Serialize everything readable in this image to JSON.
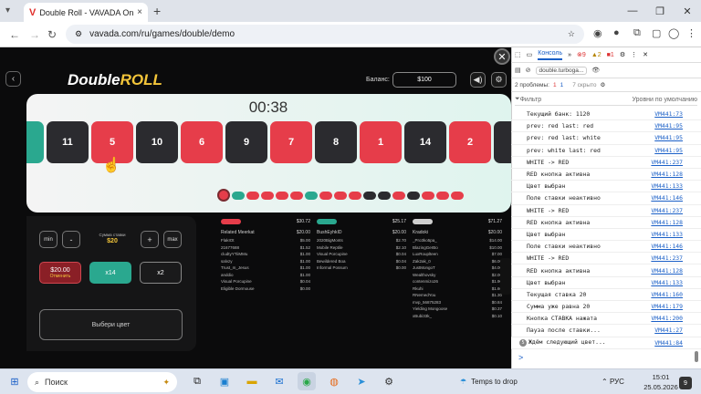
{
  "browser": {
    "tab_title": "Double Roll - VAVADA Onli",
    "tab_favicon": "V",
    "url": "vavada.com/ru/games/double/demo",
    "new_tab": "+",
    "close_tab": "×"
  },
  "game": {
    "logo_part1": "Double",
    "logo_part2": "ROLL",
    "balance_label": "Баланс:",
    "balance_value": "$100",
    "timer": "00:38",
    "tiles": [
      {
        "num": "",
        "color": "green"
      },
      {
        "num": "11",
        "color": "black"
      },
      {
        "num": "5",
        "color": "red"
      },
      {
        "num": "10",
        "color": "black"
      },
      {
        "num": "6",
        "color": "red"
      },
      {
        "num": "9",
        "color": "black"
      },
      {
        "num": "7",
        "color": "red"
      },
      {
        "num": "8",
        "color": "black"
      },
      {
        "num": "1",
        "color": "red"
      },
      {
        "num": "14",
        "color": "black"
      },
      {
        "num": "2",
        "color": "red"
      },
      {
        "num": "",
        "color": "black"
      }
    ],
    "history": [
      "red",
      "green",
      "red",
      "red",
      "red",
      "red",
      "green",
      "red",
      "red",
      "red",
      "black",
      "black",
      "red",
      "black",
      "red",
      "red",
      "red"
    ],
    "controls": {
      "min": "min",
      "minus": "-",
      "bet_label": "Сумма ставки",
      "bet_value": "$20",
      "plus": "+",
      "max": "max"
    },
    "picks": {
      "red_amount": "$20.00",
      "red_status": "Отменить",
      "green": "x14",
      "black": "x2"
    },
    "choose_color": "Выбери цвет",
    "columns": [
      {
        "pill_color": "#e63d4a",
        "total": "$30.72",
        "title_left": "Related Meerkat",
        "title_right": "$20.00",
        "rows": [
          [
            "FlakIOt",
            "$5.00"
          ],
          [
            "21677688",
            "$1.52"
          ],
          [
            "cludtyYTiiMMu",
            "$1.00"
          ],
          [
            "salvzy",
            "$1.00"
          ],
          [
            "Trust_m_Jesus",
            "$1.00"
          ],
          [
            "anddio",
            "$1.00"
          ],
          [
            "Visual Porcupine",
            "$0.04"
          ],
          [
            "Eligible Dormouse",
            "$0.00"
          ]
        ]
      },
      {
        "pill_color": "#2aa88f",
        "total": "$25.17",
        "title_left": "BushEyhkID",
        "title_right": "$20.00",
        "rows": [
          [
            "2020BigMonts",
            "$2.70"
          ],
          [
            "Mobile Reptile",
            "$2.10"
          ],
          [
            "Visual Porcupine",
            "$0.04"
          ],
          [
            "Bewildered Boa",
            "$0.04"
          ],
          [
            "Informal Possum",
            "$0.00"
          ]
        ]
      },
      {
        "pill_color": "#cfcfcf",
        "total": "$71.27",
        "title_left": "Kradoki",
        "title_right": "$20.00",
        "rows": [
          [
            "_Pro3ko5pa_",
            "$14.00"
          ],
          [
            "BlazingGerBo",
            "$10.00"
          ],
          [
            "LuxRouplteen",
            "$7.00"
          ],
          [
            "Zak2ak_0",
            "$6.00"
          ],
          [
            "JustMongoT",
            "$4.00"
          ],
          [
            "Wealthovsky",
            "$2.00"
          ],
          [
            "contenmizo26",
            "$1.90"
          ],
          [
            "Rkuhi",
            "$1.60"
          ],
          [
            "RNemedYou",
            "$1.30"
          ],
          [
            "mvp_56875283",
            "$0.84"
          ],
          [
            "Yielding Mongoose",
            "$0.37"
          ],
          [
            "xBubi33k_",
            "$0.10"
          ]
        ]
      }
    ]
  },
  "devtools": {
    "tab_console": "Консоль",
    "errors": "9",
    "warnings": "2",
    "info": "1",
    "context": "double.turboga...",
    "filter": "Фильтр",
    "levels": "Уровни по умолчанию",
    "issues": "2 проблемы:",
    "issues_err": "1",
    "issues_info": "1",
    "hidden": "7 скрыто",
    "logs": [
      {
        "text": "Текущий банк: 1120",
        "src": "VM441:73"
      },
      {
        "text": "prev: red last: red",
        "src": "VM441:95"
      },
      {
        "text": "prev: red last: white",
        "src": "VM441:95"
      },
      {
        "text": "prev: white last: red",
        "src": "VM441:95"
      },
      {
        "text": "WHITE -> RED",
        "src": "VM441:237"
      },
      {
        "text": "RED кнопка активна",
        "src": "VM441:128"
      },
      {
        "text": "Цвет выбран",
        "src": "VM441:133"
      },
      {
        "text": "Поле ставки неактивно",
        "src": "VM441:146"
      },
      {
        "text": "WHITE -> RED",
        "src": "VM441:237"
      },
      {
        "text": "RED кнопка активна",
        "src": "VM441:128"
      },
      {
        "text": "Цвет выбран",
        "src": "VM441:133"
      },
      {
        "text": "Поле ставки неактивно",
        "src": "VM441:146"
      },
      {
        "text": "WHITE -> RED",
        "src": "VM441:237"
      },
      {
        "text": "RED кнопка активна",
        "src": "VM441:128"
      },
      {
        "text": "Цвет выбран",
        "src": "VM441:133"
      },
      {
        "text": "Текущая ставка 20",
        "src": "VM441:160"
      },
      {
        "text": "Сумма уже равна 20",
        "src": "VM441:179"
      },
      {
        "text": "Кнопка СТАВКА нажата",
        "src": "VM441:200"
      },
      {
        "text": "Пауза после ставки...",
        "src": "VM441:27"
      },
      {
        "text": "Ждём следующий цвет...",
        "src": "VM441:84",
        "count": "5"
      }
    ],
    "prompt": ">"
  },
  "taskbar": {
    "search": "Поиск",
    "weather": "Temps to drop",
    "lang": "РУС",
    "time": "15:01",
    "date": "25.05.2026",
    "notif": "9"
  }
}
